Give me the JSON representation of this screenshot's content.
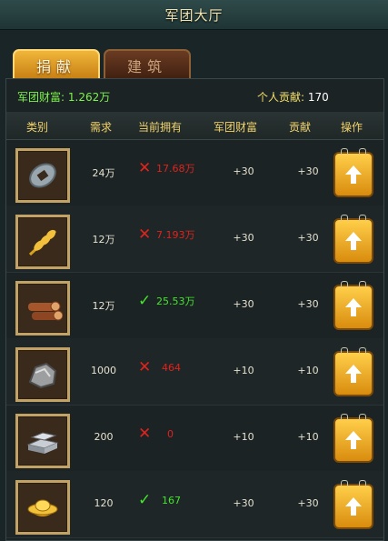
{
  "window": {
    "title": "军团大厅"
  },
  "tabs": [
    {
      "label": "捐献",
      "active": true
    },
    {
      "label": "建筑",
      "active": false
    }
  ],
  "summary": {
    "legion_wealth_label": "军团财富:",
    "legion_wealth_value": "1.262万",
    "personal_contribution_label": "个人贡献:",
    "personal_contribution_value": "170"
  },
  "columns": [
    "类别",
    "需求",
    "当前拥有",
    "军团财富",
    "贡献",
    "操作"
  ],
  "rows": [
    {
      "icon": "coin-icon",
      "requirement": "24万",
      "have_status": "insufficient",
      "have_value": "17.68万",
      "wealth": "+30",
      "contribution": "+30"
    },
    {
      "icon": "wheat-icon",
      "requirement": "12万",
      "have_status": "insufficient",
      "have_value": "7.193万",
      "wealth": "+30",
      "contribution": "+30"
    },
    {
      "icon": "wood-logs-icon",
      "requirement": "12万",
      "have_status": "sufficient",
      "have_value": "25.53万",
      "wealth": "+30",
      "contribution": "+30"
    },
    {
      "icon": "ore-rock-icon",
      "requirement": "1000",
      "have_status": "insufficient",
      "have_value": "464",
      "wealth": "+10",
      "contribution": "+10"
    },
    {
      "icon": "iron-ingot-icon",
      "requirement": "200",
      "have_status": "insufficient",
      "have_value": "0",
      "wealth": "+10",
      "contribution": "+10"
    },
    {
      "icon": "gold-ingot-icon",
      "requirement": "120",
      "have_status": "sufficient",
      "have_value": "167",
      "wealth": "+30",
      "contribution": "+30"
    }
  ],
  "colors": {
    "insufficient": "#e0231c",
    "sufficient": "#43e52a",
    "header_text": "#f2d36b",
    "button": "#f0aa22"
  }
}
